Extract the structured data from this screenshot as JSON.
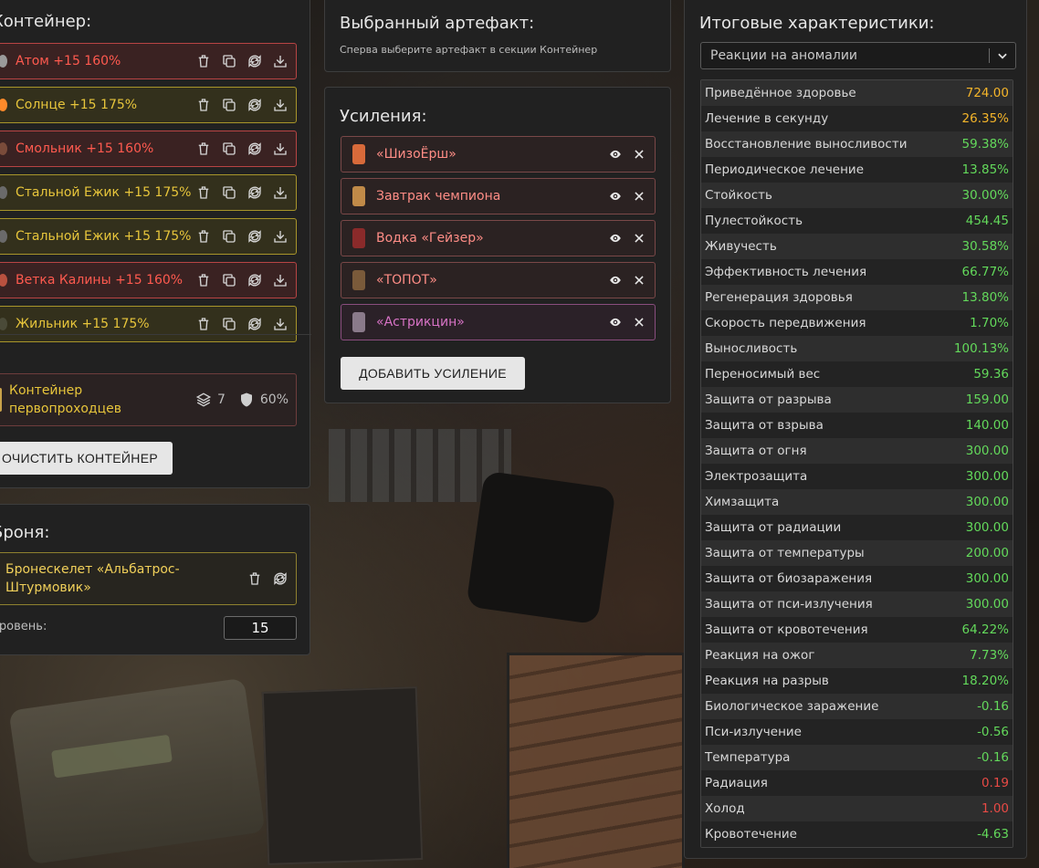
{
  "container": {
    "title": "Контейнер:",
    "artifacts": [
      {
        "label": "Атом +15 160%",
        "color": "red"
      },
      {
        "label": "Солнце +15 175%",
        "color": "yellow"
      },
      {
        "label": "Смольник +15 160%",
        "color": "red"
      },
      {
        "label": "Стальной Ежик +15 175%",
        "color": "yellow"
      },
      {
        "label": "Стальной Ежик +15 175%",
        "color": "yellow"
      },
      {
        "label": "Ветка Калины +15 160%",
        "color": "red"
      },
      {
        "label": "Жильник +15 175%",
        "color": "yellow"
      }
    ],
    "card": {
      "name": "Контейнер первопроходцев",
      "slots": "7",
      "protection": "60%"
    },
    "clear_label": "ОЧИСТИТЬ КОНТЕЙНЕР"
  },
  "armor": {
    "title": "Броня:",
    "name": "Бронескелет «Альбатрос-Штурмовик»",
    "level_label": "Уровень:",
    "level_value": "15"
  },
  "selected": {
    "title": "Выбранный артефакт:",
    "hint": "Сперва выберите артефакт в секции Контейнер"
  },
  "boosts": {
    "title": "Усиления:",
    "items": [
      {
        "label": "«ШизоЁрш»",
        "icon": "bottle-icon"
      },
      {
        "label": "Завтрак чемпиона",
        "icon": "bowl-icon"
      },
      {
        "label": "Водка «Гейзер»",
        "icon": "vodka-bottle-icon"
      },
      {
        "label": "«ТОПОТ»",
        "icon": "stick-icon"
      },
      {
        "label": "«Астрикцин»",
        "icon": "syringe-icon"
      }
    ],
    "add_label": "ДОБАВИТЬ УСИЛЕНИЕ"
  },
  "stats": {
    "title": "Итоговые характеристики:",
    "select_value": "Реакции на аномалии",
    "rows": [
      {
        "name": "Приведённое здоровье",
        "value": "724.00",
        "color": "#f5b52a"
      },
      {
        "name": "Лечение в секунду",
        "value": "26.35%",
        "color": "#f5b52a"
      },
      {
        "name": "Восстановление выносливости",
        "value": "59.38%",
        "color": "#63d95b"
      },
      {
        "name": "Периодическое лечение",
        "value": "13.85%",
        "color": "#63d95b"
      },
      {
        "name": "Стойкость",
        "value": "30.00%",
        "color": "#63d95b"
      },
      {
        "name": "Пулестойкость",
        "value": "454.45",
        "color": "#63d95b"
      },
      {
        "name": "Живучесть",
        "value": "30.58%",
        "color": "#63d95b"
      },
      {
        "name": "Эффективность лечения",
        "value": "66.77%",
        "color": "#63d95b"
      },
      {
        "name": "Регенерация здоровья",
        "value": "13.80%",
        "color": "#63d95b"
      },
      {
        "name": "Скорость передвижения",
        "value": "1.70%",
        "color": "#63d95b"
      },
      {
        "name": "Выносливость",
        "value": "100.13%",
        "color": "#63d95b"
      },
      {
        "name": "Переносимый вес",
        "value": "59.36",
        "color": "#63d95b"
      },
      {
        "name": "Защита от разрыва",
        "value": "159.00",
        "color": "#63d95b"
      },
      {
        "name": "Защита от взрыва",
        "value": "140.00",
        "color": "#63d95b"
      },
      {
        "name": "Защита от огня",
        "value": "300.00",
        "color": "#63d95b"
      },
      {
        "name": "Электрозащита",
        "value": "300.00",
        "color": "#63d95b"
      },
      {
        "name": "Химзащита",
        "value": "300.00",
        "color": "#63d95b"
      },
      {
        "name": "Защита от радиации",
        "value": "300.00",
        "color": "#63d95b"
      },
      {
        "name": "Защита от температуры",
        "value": "200.00",
        "color": "#63d95b"
      },
      {
        "name": "Защита от биозаражения",
        "value": "300.00",
        "color": "#63d95b"
      },
      {
        "name": "Защита от пси-излучения",
        "value": "300.00",
        "color": "#63d95b"
      },
      {
        "name": "Защита от кровотечения",
        "value": "64.22%",
        "color": "#63d95b"
      },
      {
        "name": "Реакция на ожог",
        "value": "7.73%",
        "color": "#63d95b"
      },
      {
        "name": "Реакция на разрыв",
        "value": "18.20%",
        "color": "#63d95b"
      },
      {
        "name": "Биологическое заражение",
        "value": "-0.16",
        "color": "#63d95b"
      },
      {
        "name": "Пси-излучение",
        "value": "-0.56",
        "color": "#63d95b"
      },
      {
        "name": "Температура",
        "value": "-0.16",
        "color": "#63d95b"
      },
      {
        "name": "Радиация",
        "value": "0.19",
        "color": "#e84a45"
      },
      {
        "name": "Холод",
        "value": "1.00",
        "color": "#e84a45"
      },
      {
        "name": "Кровотечение",
        "value": "-4.63",
        "color": "#63d95b"
      }
    ]
  }
}
